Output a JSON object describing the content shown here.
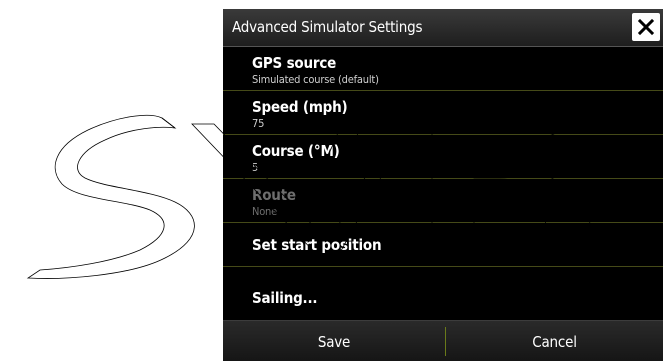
{
  "dialog": {
    "title": "Advanced Simulator Settings",
    "close_icon": "close-icon"
  },
  "settings": [
    {
      "label": "GPS source",
      "value": "Simulated course (default)",
      "enabled": true
    },
    {
      "label": "Speed (mph)",
      "value": "75",
      "enabled": true
    },
    {
      "label": "Course (°M)",
      "value": "5",
      "enabled": true
    },
    {
      "label": "Route",
      "value": "None",
      "enabled": false
    },
    {
      "label": "Set start position",
      "enabled": true
    },
    {
      "label": "Sailing...",
      "enabled": true
    }
  ],
  "footer": {
    "save_label": "Save",
    "cancel_label": "Cancel"
  },
  "colors": {
    "dialog_bg": "#000000",
    "divider": "#454a18",
    "disabled_text": "#6e6e6e",
    "watermark_stroke": "#000000"
  },
  "watermark": {
    "name": "svb-logo-watermark",
    "text": "SVB"
  }
}
